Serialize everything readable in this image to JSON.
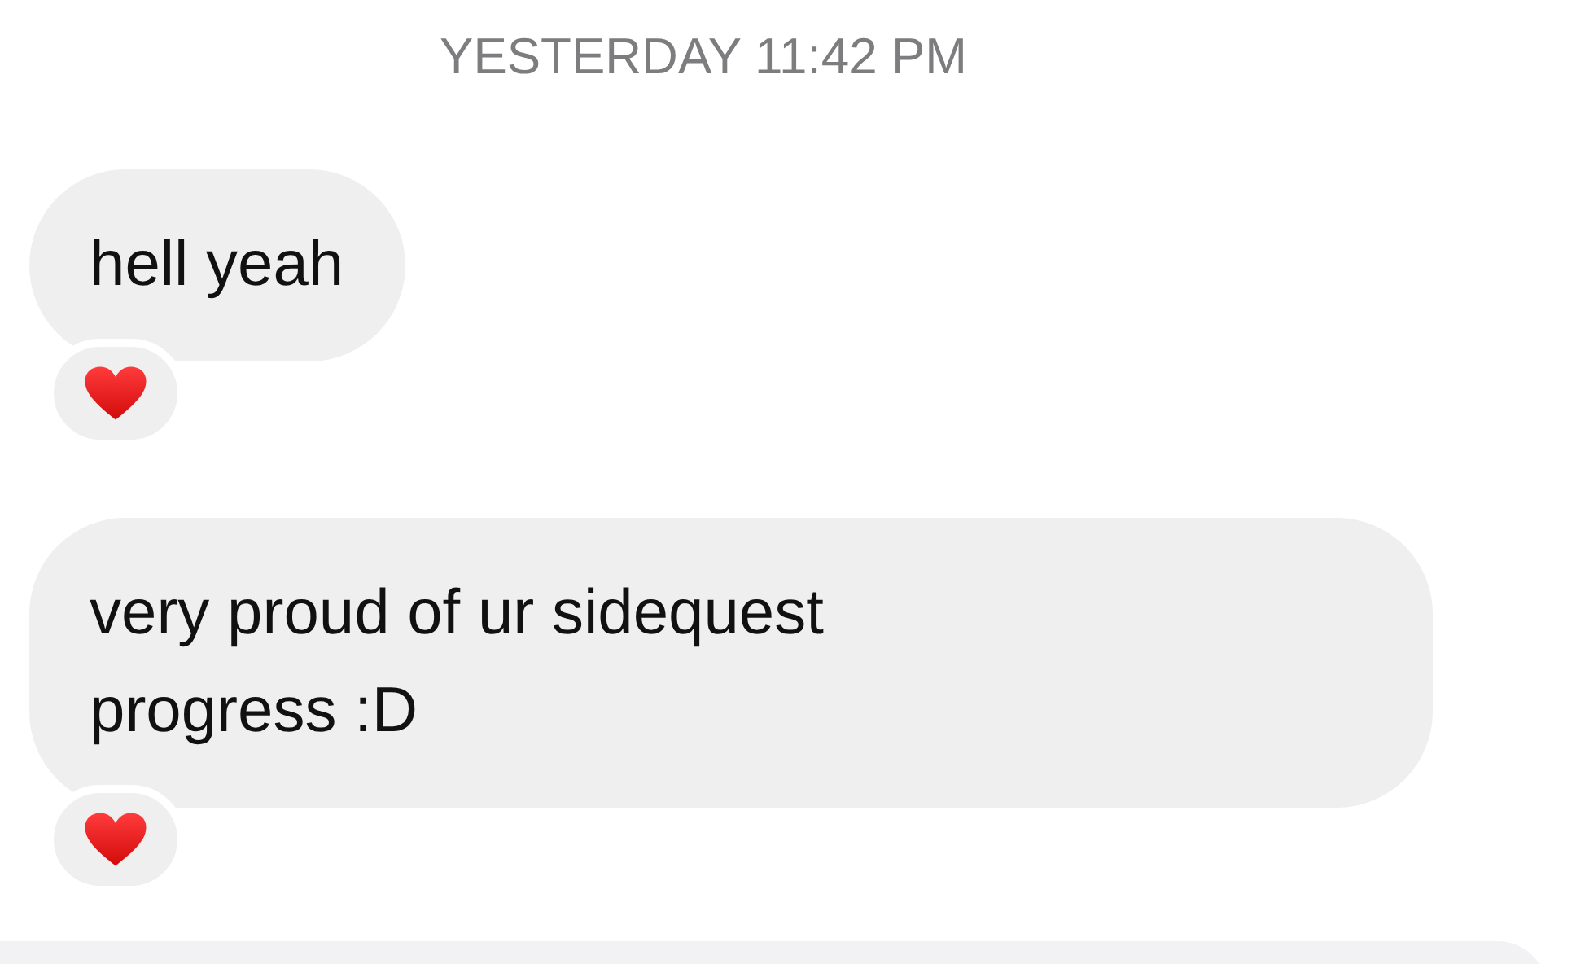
{
  "timestamp": "YESTERDAY 11:42 PM",
  "messages": [
    {
      "text": "hell yeah",
      "hearted": true
    },
    {
      "text": "very proud of ur sidequest progress :D",
      "hearted": true
    }
  ]
}
